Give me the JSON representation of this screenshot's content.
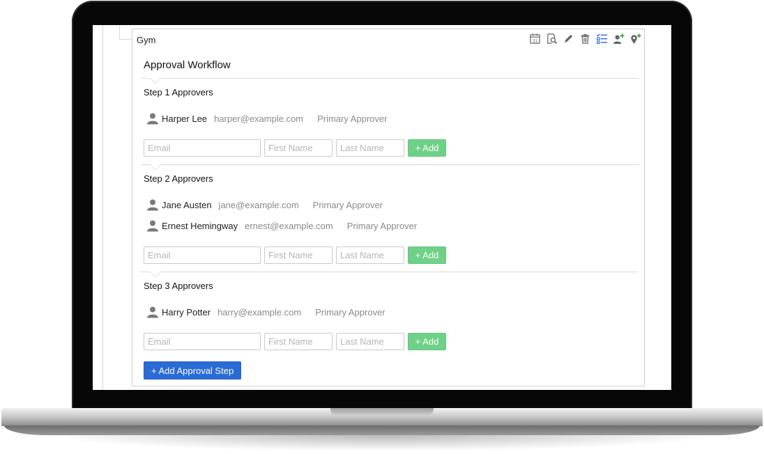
{
  "panel": {
    "title": "Gym"
  },
  "toolbar": {
    "calendar_day": "31",
    "icons": [
      "calendar-icon",
      "search-document-icon",
      "edit-icon",
      "trash-icon",
      "checklist-icon",
      "add-user-icon",
      "add-location-icon"
    ]
  },
  "workflow": {
    "title": "Approval Workflow",
    "steps": [
      {
        "title": "Step 1 Approvers",
        "approvers": [
          {
            "name": "Harper Lee",
            "email": "harper@example.com",
            "role": "Primary Approver"
          }
        ]
      },
      {
        "title": "Step 2 Approvers",
        "approvers": [
          {
            "name": "Jane Austen",
            "email": "jane@example.com",
            "role": "Primary Approver"
          },
          {
            "name": "Ernest Hemingway",
            "email": "ernest@example.com",
            "role": "Primary Approver"
          }
        ]
      },
      {
        "title": "Step 3 Approvers",
        "approvers": [
          {
            "name": "Harry Potter",
            "email": "harry@example.com",
            "role": "Primary Approver"
          }
        ]
      }
    ],
    "form": {
      "email_placeholder": "Email",
      "first_placeholder": "First Name",
      "last_placeholder": "Last Name",
      "add_label": "+ Add"
    },
    "add_step_label": "+ Add Approval Step"
  },
  "colors": {
    "add_button": "#6fd187",
    "primary_button": "#2a6bd6",
    "icon_gray": "#666666",
    "icon_blue": "#2a6bd6",
    "icon_green": "#3fae49"
  }
}
